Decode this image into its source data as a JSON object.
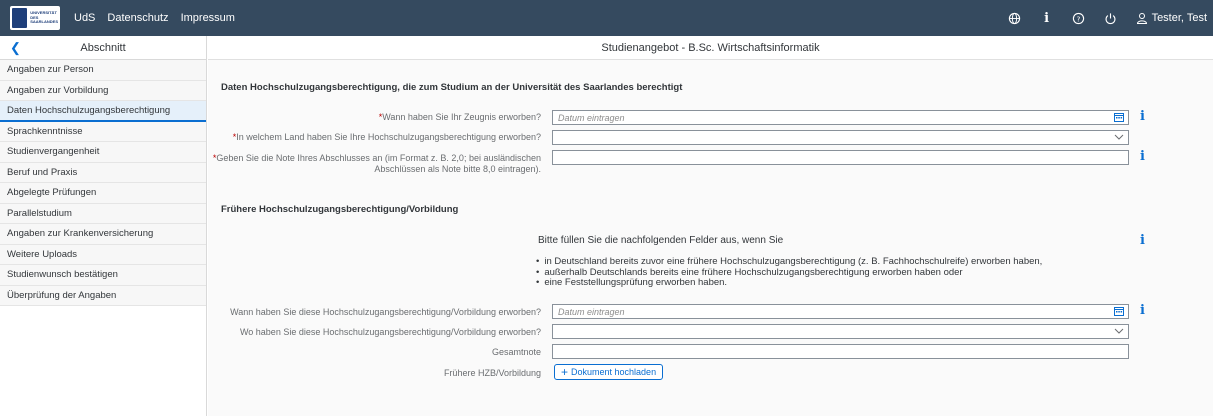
{
  "topbar": {
    "logo_text": [
      "UNIVERSITÄT",
      "DES",
      "SAARLANDES"
    ],
    "links": [
      "UdS",
      "Datenschutz",
      "Impressum"
    ],
    "user_name": "Tester, Test",
    "icons": [
      "globe-icon",
      "info-icon",
      "help-icon",
      "power-icon",
      "user-icon"
    ]
  },
  "sidebar": {
    "title": "Abschnitt",
    "items": [
      {
        "label": "Angaben zur Person"
      },
      {
        "label": "Angaben zur Vorbildung"
      },
      {
        "label": "Daten Hochschulzugangsberechtigung",
        "active": true
      },
      {
        "label": "Sprachkenntnisse"
      },
      {
        "label": "Studienvergangenheit"
      },
      {
        "label": "Beruf und Praxis"
      },
      {
        "label": "Abgelegte Prüfungen"
      },
      {
        "label": "Parallelstudium"
      },
      {
        "label": "Angaben zur Krankenversicherung"
      },
      {
        "label": "Weitere Uploads"
      },
      {
        "label": "Studienwunsch bestätigen"
      },
      {
        "label": "Überprüfung der Angaben"
      }
    ]
  },
  "main": {
    "title": "Studienangebot - B.Sc. Wirtschaftsinformatik",
    "section1": {
      "heading": "Daten Hochschulzugangsberechtigung, die zum Studium an der Universität des Saarlandes berechtigt",
      "q1_label": "Wann haben Sie Ihr Zeugnis erworben?",
      "q1_placeholder": "Datum eintragen",
      "q2_label": "In welchem Land haben Sie Ihre Hochschulzugangsberechtigung erworben?",
      "q3_label_line1": "Geben Sie die Note Ihres Abschlusses an (im Format z. B. 2,0; bei ausländischen",
      "q3_label_line2": "Abschlüssen als Note bitte 8,0 eintragen)."
    },
    "section2": {
      "heading": "Frühere Hochschulzugangsberechtigung/Vorbildung",
      "note": "Bitte füllen Sie die nachfolgenden Felder aus, wenn Sie",
      "bullets": [
        "in Deutschland bereits zuvor eine frühere Hochschulzugangsberechtigung (z. B. Fachhochschulreife) erworben haben,",
        "außerhalb Deutschlands bereits eine frühere Hochschulzugangsberechtigung erworben haben oder",
        "eine Feststellungsprüfung erworben haben."
      ],
      "f1_label": "Wann haben Sie diese Hochschulzugangsberechtigung/Vorbildung erworben?",
      "f1_placeholder": "Datum eintragen",
      "f2_label": "Wo haben Sie diese Hochschulzugangsberechtigung/Vorbildung erworben?",
      "f3_label": "Gesamtnote",
      "f4_label": "Frühere HZB/Vorbildung",
      "upload_label": "Dokument hochladen"
    },
    "info_glyph": "i"
  },
  "colors": {
    "topbar": "#354a5f",
    "accent": "#0a6ed1",
    "required": "#bb0000"
  }
}
